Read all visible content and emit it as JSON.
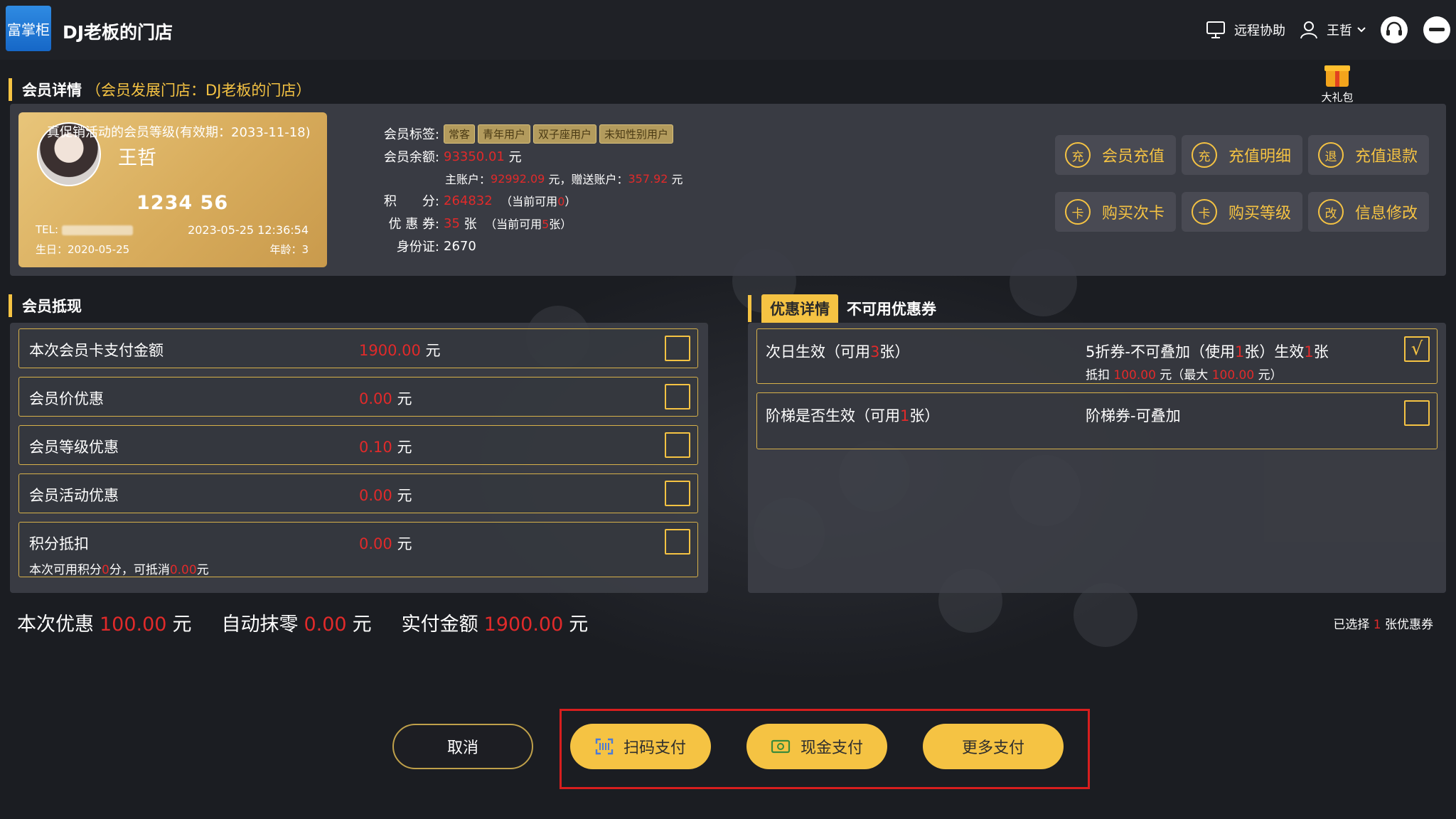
{
  "app": {
    "logo_text": "富掌柜",
    "title": "DJ老板的门店"
  },
  "topbar": {
    "remote_label": "远程协助",
    "user_name": "王哲"
  },
  "member_section": {
    "title": "会员详情",
    "store_note": "（会员发展门店：DJ老板的门店）"
  },
  "gift": {
    "label": "大礼包"
  },
  "card": {
    "level_text": "真促销活动的会员等级(有效期：2033-11-18)",
    "name": "王哲",
    "number": "1234 56",
    "tel_label": "TEL:",
    "datetime": "2023-05-25 12:36:54",
    "birthday": "生日：2020-05-25",
    "age": "年龄：3"
  },
  "info": {
    "tags_label": "会员标签:",
    "tags": [
      "常客",
      "青年用户",
      "双子座用户",
      "未知性别用户"
    ],
    "balance_label": "会员余额:",
    "balance": "93350.01",
    "yuan": "元",
    "main_label": "主账户：",
    "main_value": "92992.09",
    "gift_label": "元，赠送账户：",
    "gift_value": "357.92",
    "points_label": "积　　分:",
    "points_value": "264832",
    "points_avail_pre": "（当前可用",
    "points_avail_value": "0",
    "points_avail_post": "）",
    "coupon_label": "优 惠 券:",
    "coupon_value": "35",
    "coupon_unit": "张",
    "coupon_avail_pre": "（当前可用",
    "coupon_avail_value": "5",
    "coupon_avail_post": "张）",
    "id_label": "身份证:",
    "id_value": "2670"
  },
  "actions": [
    {
      "icon": "充",
      "label": "会员充值"
    },
    {
      "icon": "充",
      "label": "充值明细"
    },
    {
      "icon": "退",
      "label": "充值退款"
    },
    {
      "icon": "卡",
      "label": "购买次卡"
    },
    {
      "icon": "卡",
      "label": "购买等级"
    },
    {
      "icon": "改",
      "label": "信息修改"
    }
  ],
  "offset_section": {
    "title": "会员抵现"
  },
  "offset_rows": [
    {
      "label": "本次会员卡支付金额",
      "value": "1900.00",
      "unit": "元"
    },
    {
      "label": "会员价优惠",
      "value": "0.00",
      "unit": "元"
    },
    {
      "label": "会员等级优惠",
      "value": "0.10",
      "unit": "元"
    },
    {
      "label": "会员活动优惠",
      "value": "0.00",
      "unit": "元"
    },
    {
      "label": "积分抵扣",
      "value": "0.00",
      "unit": "元"
    }
  ],
  "points_note": {
    "pre": "本次可用积分",
    "points": "0",
    "mid": "分，可抵消",
    "amount": "0.00",
    "post": "元"
  },
  "coupon_tabs": {
    "active": "优惠详情",
    "inactive": "不可用优惠券"
  },
  "coupons": [
    {
      "left_pre": "次日生效（可用",
      "left_count": "3",
      "left_post": "张）",
      "right_pre": "5折券-不可叠加（使用",
      "right_use": "1",
      "right_mid": "张）生效",
      "right_eff": "1",
      "right_post": "张",
      "detail_pre": "抵扣",
      "detail_amount": "100.00",
      "detail_mid": "元（最大",
      "detail_max": "100.00",
      "detail_post": "元）",
      "checked": true,
      "check_mark": "√"
    },
    {
      "left_pre": "阶梯是否生效（可用",
      "left_count": "1",
      "left_post": "张）",
      "right_title": "阶梯券-可叠加",
      "checked": false
    }
  ],
  "summary": {
    "discount_label": "本次优惠",
    "discount_value": "100.00",
    "round_label": "自动抹零",
    "round_value": "0.00",
    "paid_label": "实付金额",
    "paid_value": "1900.00",
    "unit": "元",
    "selected_pre": "已选择",
    "selected_count": "1",
    "selected_post": "张优惠券"
  },
  "buttons": {
    "cancel": "取消",
    "scan": "扫码支付",
    "cash": "现金支付",
    "more": "更多支付"
  },
  "colors": {
    "accent": "#f5c343",
    "danger": "#e12a2a",
    "card_gold": "#d8ac5c"
  }
}
